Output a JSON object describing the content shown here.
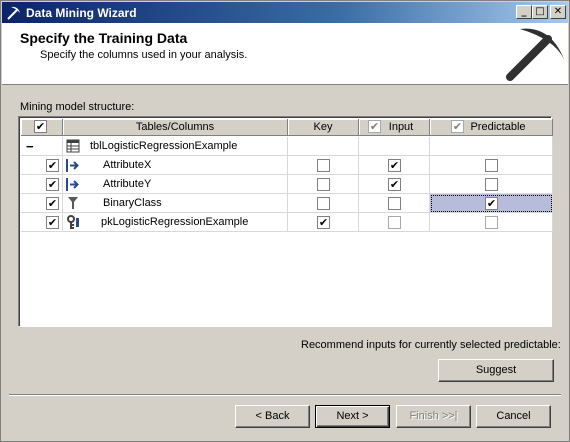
{
  "window": {
    "title": "Data Mining Wizard",
    "controls": {
      "minimize": "_",
      "maximize": "□",
      "close": "✕"
    }
  },
  "header": {
    "title": "Specify the Training Data",
    "subtitle": "Specify the columns used in your analysis.",
    "logo_icon": "pickaxe-icon"
  },
  "structure_label": "Mining model structure:",
  "grid": {
    "columns": {
      "tables_columns": "Tables/Columns",
      "key": "Key",
      "input": "Input",
      "predictable": "Predictable"
    },
    "table": {
      "expander": "−",
      "name": "tblLogisticRegressionExample",
      "icon": "table-icon"
    },
    "rows": [
      {
        "name": "AttributeX",
        "icon": "input-column-icon",
        "included": true,
        "key": false,
        "input": true,
        "predictable": false
      },
      {
        "name": "AttributeY",
        "icon": "input-column-icon",
        "included": true,
        "key": false,
        "input": true,
        "predictable": false
      },
      {
        "name": "BinaryClass",
        "icon": "predictable-column-icon",
        "included": true,
        "key": false,
        "input": false,
        "predictable": true
      },
      {
        "name": "pkLogisticRegressionExample",
        "icon": "key-column-icon",
        "included": true,
        "key": true,
        "input": false,
        "predictable": false
      }
    ]
  },
  "recommend_text": "Recommend inputs for currently selected predictable:",
  "buttons": {
    "suggest": "Suggest",
    "back": "< Back",
    "next": "Next >",
    "finish": "Finish >>|",
    "cancel": "Cancel"
  },
  "colors": {
    "title_bar": "#0a246a",
    "dialog_bg": "#d4d0c8",
    "selection": "#b6bcda"
  }
}
